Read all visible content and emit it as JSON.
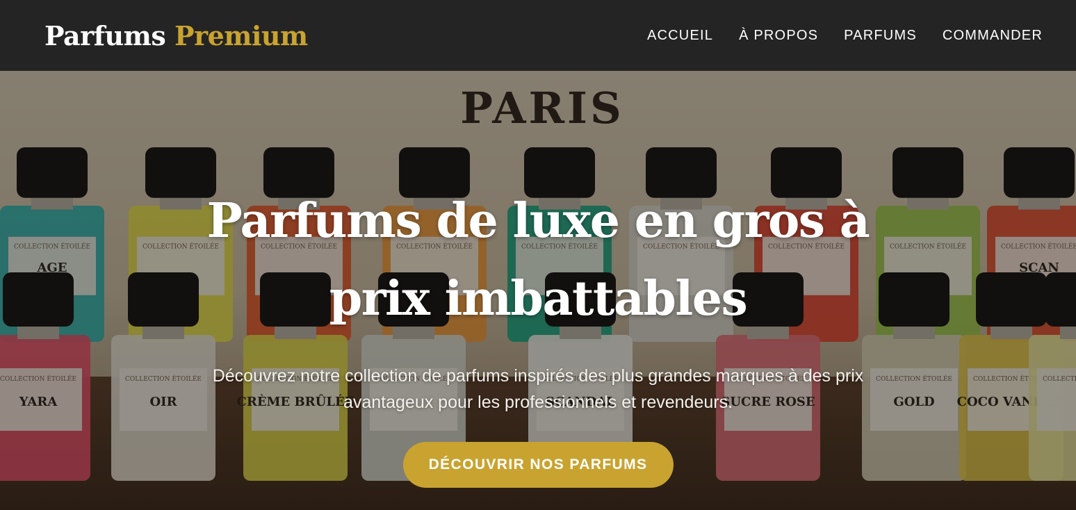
{
  "brand": {
    "name_primary": "Parfums",
    "name_accent": "Premium",
    "accent_color": "#c9a330"
  },
  "nav": {
    "items": [
      {
        "label": "ACCUEIL"
      },
      {
        "label": "À PROPOS"
      },
      {
        "label": "PARFUMS"
      },
      {
        "label": "COMMANDER"
      }
    ]
  },
  "hero": {
    "title": "Parfums de luxe en gros à prix imbattables",
    "subtitle": "Découvrez notre collection de parfums inspirés des plus grandes marques à des prix avantageux pour les professionnels et revendeurs.",
    "cta_label": "DÉCOUVRIR NOS PARFUMS",
    "background": {
      "sign_text": "PARIS",
      "bottle_labels": [
        "AGE",
        "YARA",
        "OIR",
        "CRÈME BRÛLÉE",
        "SCANDAL",
        "SUCRE ROSE",
        "GOLD",
        "COCO VANILLE",
        "SCAN"
      ],
      "collection_label": "COLLECTION ÉTOILÉE"
    }
  }
}
